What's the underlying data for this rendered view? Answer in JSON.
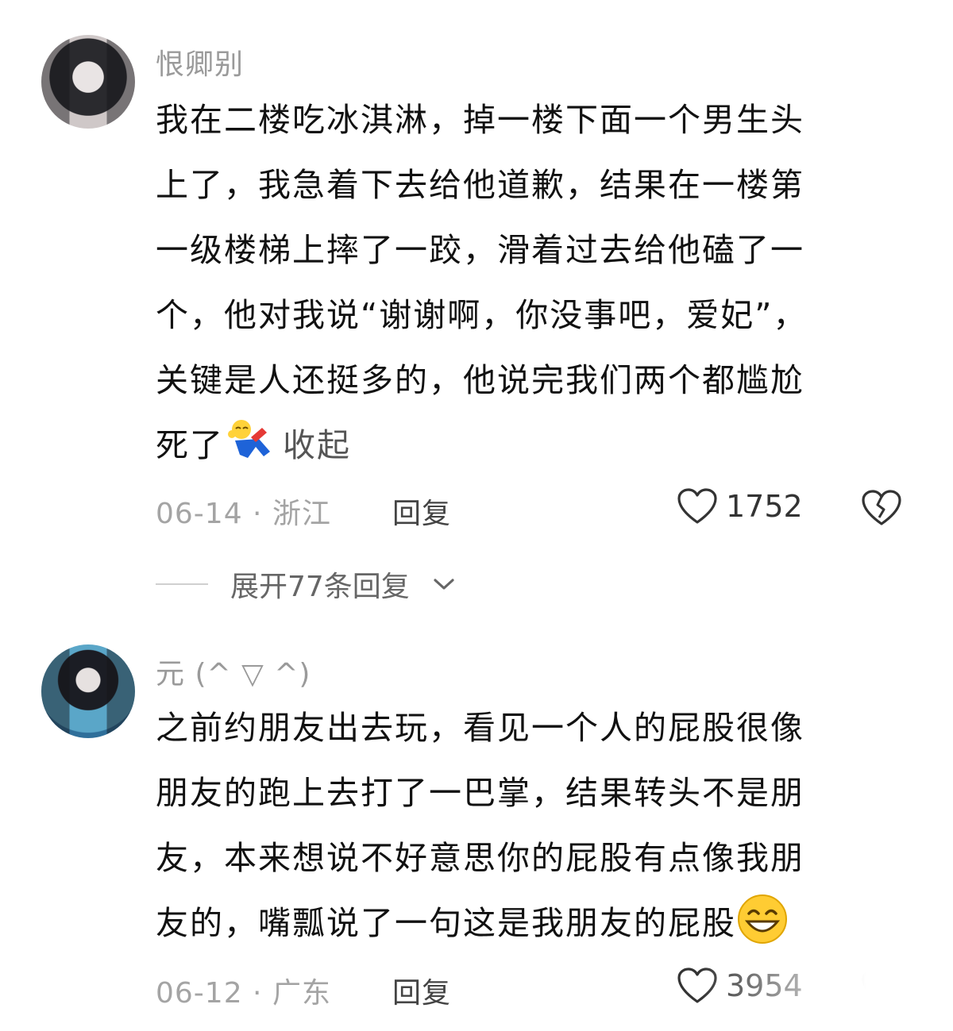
{
  "comments": [
    {
      "username": "恨卿别",
      "lines": [
        "我在二楼吃冰淇淋，掉一楼下面一个男生头",
        "上了，我急着下去给他道歉，结果在一楼第",
        "一级楼梯上摔了一跤，滑着过去给他磕了一",
        "个，他对我说“谢谢啊，你没事吧，爱妃”，",
        "关键是人还挺多的，他说完我们两个都尴尬",
        "死了"
      ],
      "collapse_label": "收起",
      "date": "06-14",
      "location": "浙江",
      "reply_label": "回复",
      "likes": "1752",
      "expand_replies": "展开77条回复"
    },
    {
      "username": "元 (^ ▽ ^)",
      "lines": [
        "之前约朋友出去玩，看见一个人的屁股很像",
        "朋友的跑上去打了一巴掌，结果转头不是朋",
        "友，本来想说不好意思你的屁股有点像我朋",
        "友的，嘴瓢说了一句这是我朋友的屁股"
      ],
      "date": "06-12",
      "location": "广东",
      "reply_label": "回复",
      "likes": "3954"
    }
  ],
  "separator": " · ",
  "icons": [
    "heart-outline-icon",
    "broken-heart-icon",
    "chevron-down-icon",
    "falling-person-emoji",
    "grinning-face-emoji"
  ]
}
